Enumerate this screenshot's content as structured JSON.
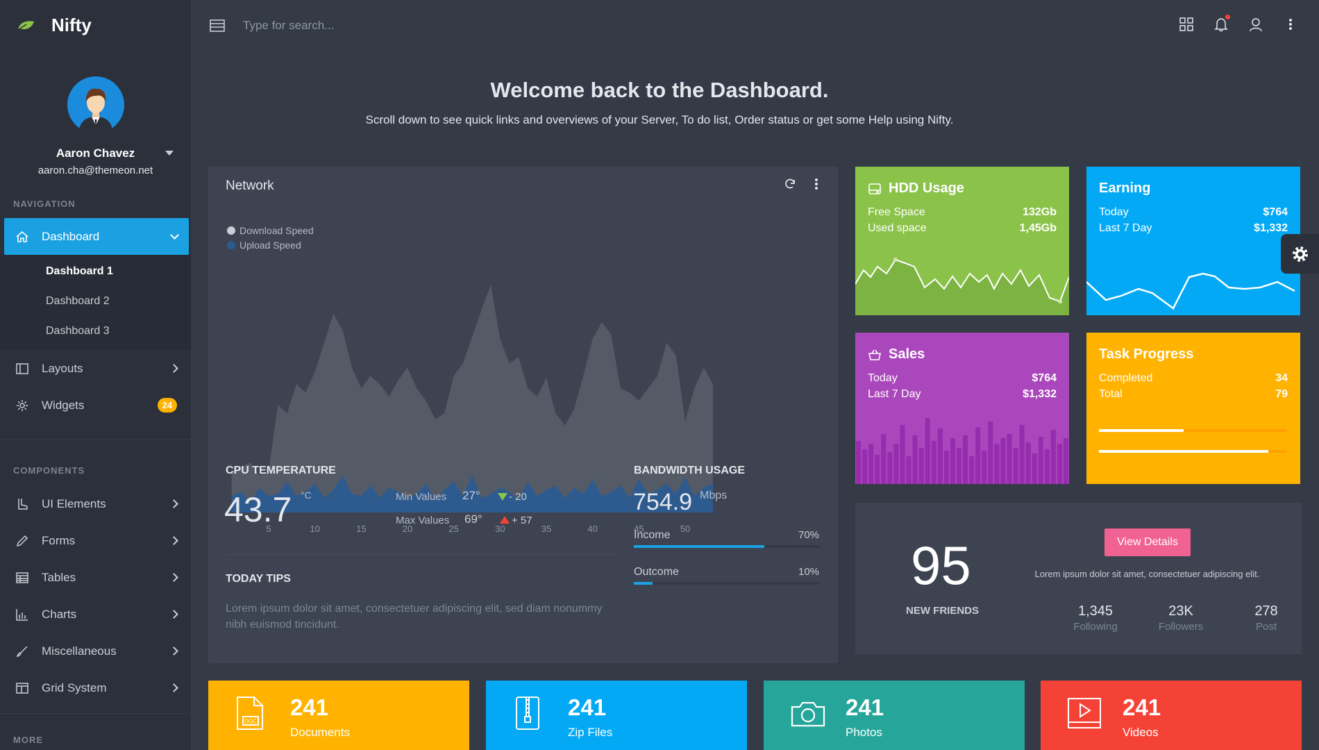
{
  "brand": {
    "name": "Nifty",
    "logo_icon": "leaf-icon",
    "logo_color": "#8bc34a"
  },
  "profile": {
    "name": "Aaron Chavez",
    "email": "aaron.cha@themeon.net"
  },
  "sidebar": {
    "navigation_label": "NAVIGATION",
    "components_label": "COMPONENTS",
    "more_label": "MORE",
    "dashboard": {
      "label": "Dashboard",
      "icon": "home-icon",
      "subitems": [
        "Dashboard 1",
        "Dashboard 2",
        "Dashboard 3"
      ]
    },
    "nav_items": [
      {
        "label": "Layouts",
        "icon": "layout-icon"
      },
      {
        "label": "Widgets",
        "icon": "gear-icon",
        "badge": "24"
      }
    ],
    "component_items": [
      {
        "label": "UI Elements",
        "icon": "boot-icon"
      },
      {
        "label": "Forms",
        "icon": "pencil-icon"
      },
      {
        "label": "Tables",
        "icon": "table-icon"
      },
      {
        "label": "Charts",
        "icon": "bar-chart-icon"
      },
      {
        "label": "Miscellaneous",
        "icon": "brush-icon"
      },
      {
        "label": "Grid System",
        "icon": "grid-icon"
      }
    ]
  },
  "header": {
    "search_placeholder": "Type for search..."
  },
  "welcome": {
    "title": "Welcome back to the Dashboard.",
    "subtitle": "Scroll down to see quick links and overviews of your Server, To do list, Order status or get some Help using Nifty."
  },
  "network": {
    "title": "Network",
    "legend": [
      "Download Speed",
      "Upload Speed"
    ],
    "cpu": {
      "title": "CPU TEMPERATURE",
      "value": "43.7",
      "unit": "°C",
      "min_label": "Min Values",
      "min_value": "27°",
      "min_delta": "- 20",
      "max_label": "Max Values",
      "max_value": "69°",
      "max_delta": "+ 57"
    },
    "bandwidth": {
      "title": "BANDWIDTH USAGE",
      "value": "754.9",
      "unit": "Mbps",
      "income_label": "Income",
      "income_pct": "70%",
      "income_fill": 0.7,
      "outcome_label": "Outcome",
      "outcome_pct": "10%",
      "outcome_fill": 0.1
    },
    "tips": {
      "title": "TODAY TIPS",
      "text": "Lorem ipsum dolor sit amet, consectetuer adipiscing elit, sed diam nonummy nibh euismod tincidunt."
    }
  },
  "chart_data": {
    "type": "area",
    "x": [
      1,
      2,
      3,
      4,
      5,
      6,
      7,
      8,
      9,
      10,
      11,
      12,
      13,
      14,
      15,
      16,
      17,
      18,
      19,
      20,
      21,
      22,
      23,
      24,
      25,
      26,
      27,
      28,
      29,
      30,
      31,
      32,
      33,
      34,
      35,
      36,
      37,
      38,
      39,
      40,
      41,
      42,
      43,
      44,
      45,
      46,
      47,
      48,
      49,
      50,
      51,
      52,
      53
    ],
    "xticks": [
      5,
      10,
      15,
      20,
      25,
      30,
      35,
      40,
      45,
      50
    ],
    "xlim": [
      0.5,
      53
    ],
    "ylim": [
      0,
      100
    ],
    "grid": false,
    "legend_placement": "top-left",
    "series": [
      {
        "name": "Download Speed",
        "color": "#555b66",
        "values": [
          20,
          22,
          24,
          18,
          20,
          52,
          48,
          62,
          58,
          68,
          82,
          96,
          88,
          70,
          60,
          66,
          62,
          56,
          64,
          70,
          60,
          54,
          45,
          48,
          66,
          72,
          85,
          98,
          110,
          84,
          72,
          75,
          60,
          56,
          65,
          48,
          42,
          50,
          66,
          84,
          92,
          86,
          60,
          58,
          54,
          60,
          66,
          82,
          76,
          44,
          60,
          70,
          62
        ]
      },
      {
        "name": "Upload Speed",
        "color": "#2e5b8f",
        "values": [
          8,
          10,
          5,
          12,
          8,
          9,
          15,
          8,
          10,
          14,
          7,
          11,
          18,
          9,
          8,
          13,
          7,
          12,
          10,
          7,
          9,
          14,
          6,
          11,
          15,
          8,
          18,
          7,
          9,
          12,
          10,
          6,
          15,
          8,
          11,
          13,
          7,
          12,
          9,
          16,
          8,
          10,
          13,
          7,
          16,
          9,
          11,
          14,
          9,
          17,
          8,
          12,
          14
        ]
      }
    ]
  },
  "tiles": {
    "hdd": {
      "title": "HDD Usage",
      "icon": "hdd-icon",
      "color": "#8bc34a",
      "row1_label": "Free Space",
      "row1_value": "132Gb",
      "row2_label": "Used space",
      "row2_value": "1,45Gb"
    },
    "earning": {
      "title": "Earning",
      "color": "#03a9f4",
      "row1_label": "Today",
      "row1_value": "$764",
      "row2_label": "Last 7 Day",
      "row2_value": "$1,332"
    },
    "sales": {
      "title": "Sales",
      "icon": "basket-icon",
      "color": "#ab47bc",
      "row1_label": "Today",
      "row1_value": "$764",
      "row2_label": "Last 7 Day",
      "row2_value": "$1,332"
    },
    "task": {
      "title": "Task Progress",
      "color": "#ffb300",
      "row1_label": "Completed",
      "row1_value": "34",
      "row2_label": "Total",
      "row2_value": "79",
      "bar1_fill": 0.45,
      "bar2_fill": 0.9
    }
  },
  "friends": {
    "count": "95",
    "label": "NEW FRIENDS",
    "button": "View Details",
    "text": "Lorem ipsum dolor sit amet, consectetuer adipiscing elit.",
    "stats": [
      {
        "value": "1,345",
        "label": "Following"
      },
      {
        "value": "23K",
        "label": "Followers"
      },
      {
        "value": "278",
        "label": "Post"
      }
    ]
  },
  "bottom_cards": [
    {
      "value": "241",
      "label": "Documents",
      "icon": "document-icon",
      "color": "#ffb300"
    },
    {
      "value": "241",
      "label": "Zip Files",
      "icon": "zip-icon",
      "color": "#03a9f4"
    },
    {
      "value": "241",
      "label": "Photos",
      "icon": "camera-icon",
      "color": "#26a69a"
    },
    {
      "value": "241",
      "label": "Videos",
      "icon": "video-icon",
      "color": "#f44336"
    }
  ]
}
